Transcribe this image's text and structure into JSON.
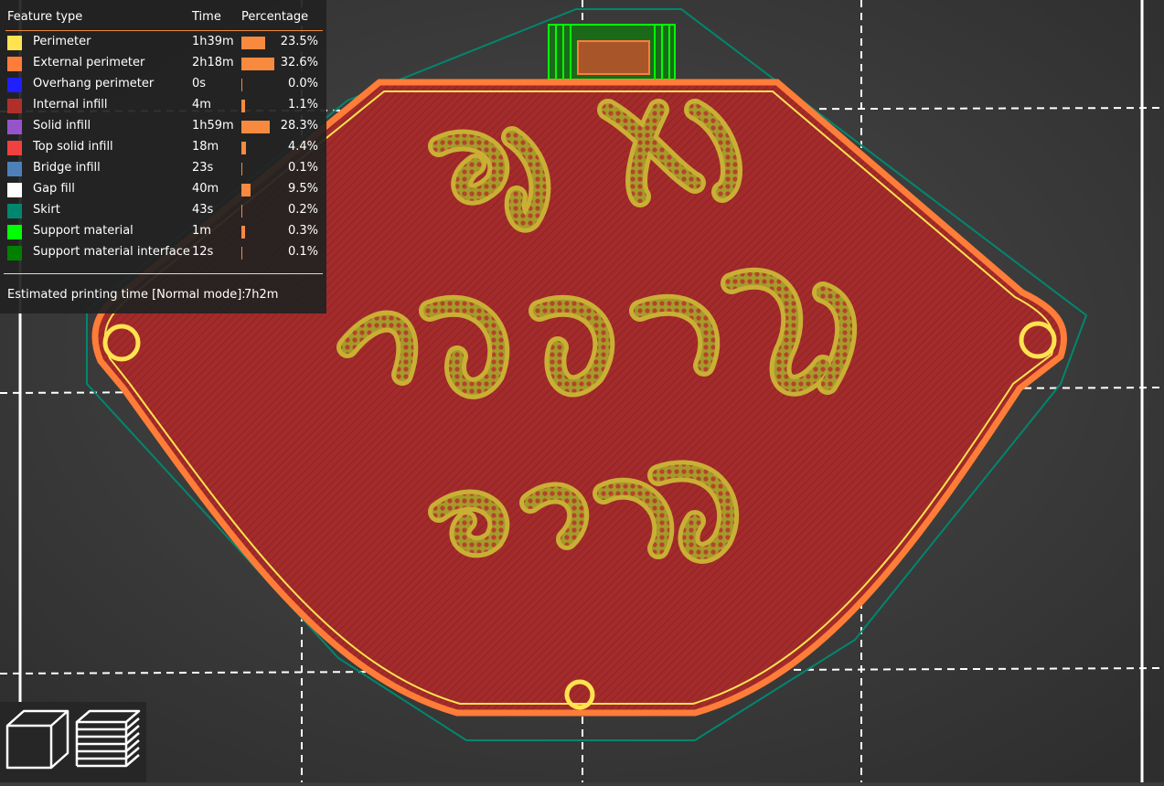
{
  "legend": {
    "headers": {
      "feature_type": "Feature type",
      "time": "Time",
      "percentage": "Percentage"
    },
    "rows": [
      {
        "name": "Perimeter",
        "time": "1h39m",
        "percent": "23.5%",
        "value": 23.5,
        "color": "#ffe34f"
      },
      {
        "name": "External perimeter",
        "time": "2h18m",
        "percent": "32.6%",
        "value": 32.6,
        "color": "#ff7d38"
      },
      {
        "name": "Overhang perimeter",
        "time": "0s",
        "percent": "0.0%",
        "value": 0.0,
        "color": "#1f1fff"
      },
      {
        "name": "Internal infill",
        "time": "4m",
        "percent": "1.1%",
        "value": 1.1,
        "color": "#b03029"
      },
      {
        "name": "Solid infill",
        "time": "1h59m",
        "percent": "28.3%",
        "value": 28.3,
        "color": "#9654cc"
      },
      {
        "name": "Top solid infill",
        "time": "18m",
        "percent": "4.4%",
        "value": 4.4,
        "color": "#f04040"
      },
      {
        "name": "Bridge infill",
        "time": "23s",
        "percent": "0.1%",
        "value": 0.1,
        "color": "#4d80ba"
      },
      {
        "name": "Gap fill",
        "time": "40m",
        "percent": "9.5%",
        "value": 9.5,
        "color": "#ffffff"
      },
      {
        "name": "Skirt",
        "time": "43s",
        "percent": "0.2%",
        "value": 0.2,
        "color": "#00876e"
      },
      {
        "name": "Support material",
        "time": "1m",
        "percent": "0.3%",
        "value": 0.3,
        "color": "#00ff00"
      },
      {
        "name": "Support material interface",
        "time": "12s",
        "percent": "0.1%",
        "value": 0.1,
        "color": "#008000"
      }
    ],
    "estimated_label": "Estimated printing time [Normal mode]:",
    "estimated_value": "7h2m"
  },
  "toolbar": {
    "buttons": [
      {
        "name": "3d-view",
        "icon": "cube-icon"
      },
      {
        "name": "preview",
        "icon": "layers-icon"
      }
    ]
  },
  "colors": {
    "background": "#3b3b3b",
    "grid": "#ffffff",
    "part_fill": "#a52c2c",
    "perimeter": "#ffe34f",
    "external_perimeter": "#ff7d38",
    "skirt": "#00876e",
    "support": "#00ff00",
    "bar": "#f78a3f"
  }
}
